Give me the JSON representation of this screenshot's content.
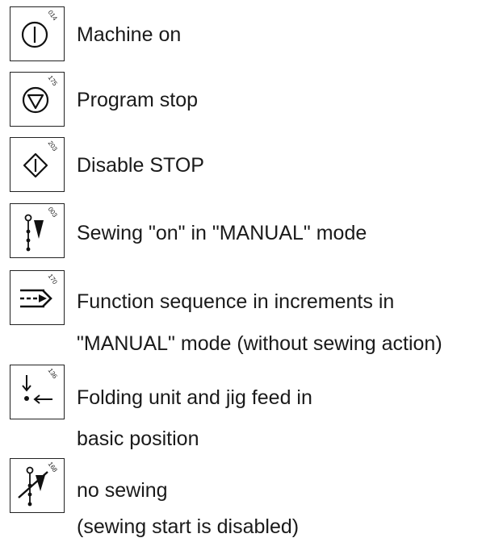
{
  "items": [
    {
      "code": "014",
      "icon": "power-circle-icon",
      "lines": [
        "Machine on"
      ]
    },
    {
      "code": "175",
      "icon": "stop-triangle-circle-icon",
      "lines": [
        "Program stop"
      ]
    },
    {
      "code": "203",
      "icon": "disable-stop-diamond-icon",
      "lines": [
        "Disable STOP"
      ]
    },
    {
      "code": "003",
      "icon": "sewing-on-needle-icon",
      "lines": [
        "Sewing \"on\" in \"MANUAL\" mode"
      ]
    },
    {
      "code": "170",
      "icon": "increment-arrow-icon",
      "lines": [
        "Function sequence in increments in",
        "\"MANUAL\" mode (without sewing action)"
      ]
    },
    {
      "code": "136",
      "icon": "basic-position-arrows-icon",
      "lines": [
        "Folding unit and jig feed in",
        "basic position"
      ]
    },
    {
      "code": "168",
      "icon": "no-sewing-icon",
      "lines": [
        "no sewing",
        "(sewing start is disabled)"
      ]
    }
  ]
}
